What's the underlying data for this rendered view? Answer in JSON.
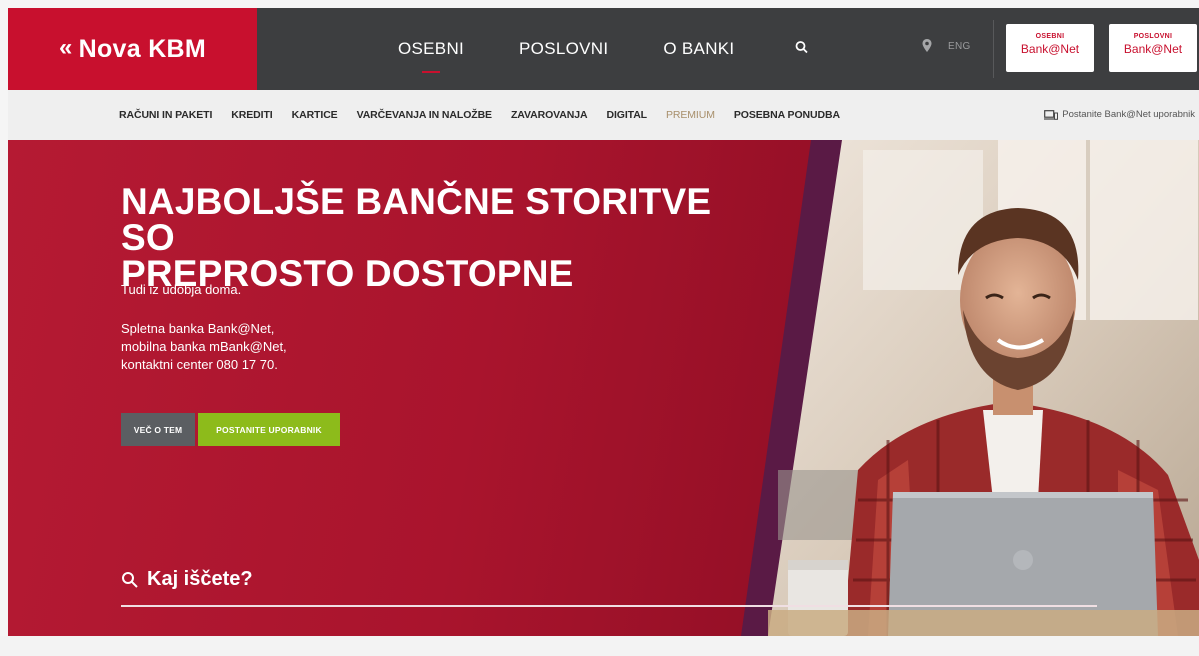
{
  "brand": {
    "name": "Nova KBM",
    "color": "#c8102e"
  },
  "top_nav": {
    "items": [
      "OSEBNI",
      "POSLOVNI",
      "O BANKI"
    ],
    "active": "OSEBNI",
    "search_icon": "search-icon",
    "location_icon": "location-pin-icon",
    "language": "ENG",
    "bank_buttons": [
      {
        "small": "OSEBNI",
        "big": "Bank@Net"
      },
      {
        "small": "POSLOVNI",
        "big": "Bank@Net"
      }
    ]
  },
  "sub_nav": {
    "links": [
      "RAČUNI IN PAKETI",
      "KREDITI",
      "KARTICE",
      "VARČEVANJA IN NALOŽBE",
      "ZAVAROVANJA",
      "DIGITAL",
      "PREMIUM",
      "POSEBNA PONUDBA"
    ],
    "cta": "Postanite Bank@Net uporabnik",
    "cta_icon": "devices-icon"
  },
  "hero": {
    "headline_line1": "NAJBOLJŠE BANČNE STORITVE SO",
    "headline_line2": "PREPROSTO DOSTOPNE",
    "tagline": "Tudi iz udobja doma.",
    "desc_line1": "Spletna banka Bank@Net,",
    "desc_line2": "mobilna banka mBank@Net,",
    "desc_line3": "kontaktni center 080 17 70.",
    "btn_more": "VEČ O TEM",
    "btn_join": "POSTANITE UPORABNIK"
  },
  "search": {
    "label": "Kaj iščete?",
    "icon": "search-icon"
  },
  "colors": {
    "red": "#c8102e",
    "dark": "#3d3e40",
    "green": "#8dbb1b",
    "grey_btn": "#5b5e62",
    "premium": "#a88f6b"
  }
}
